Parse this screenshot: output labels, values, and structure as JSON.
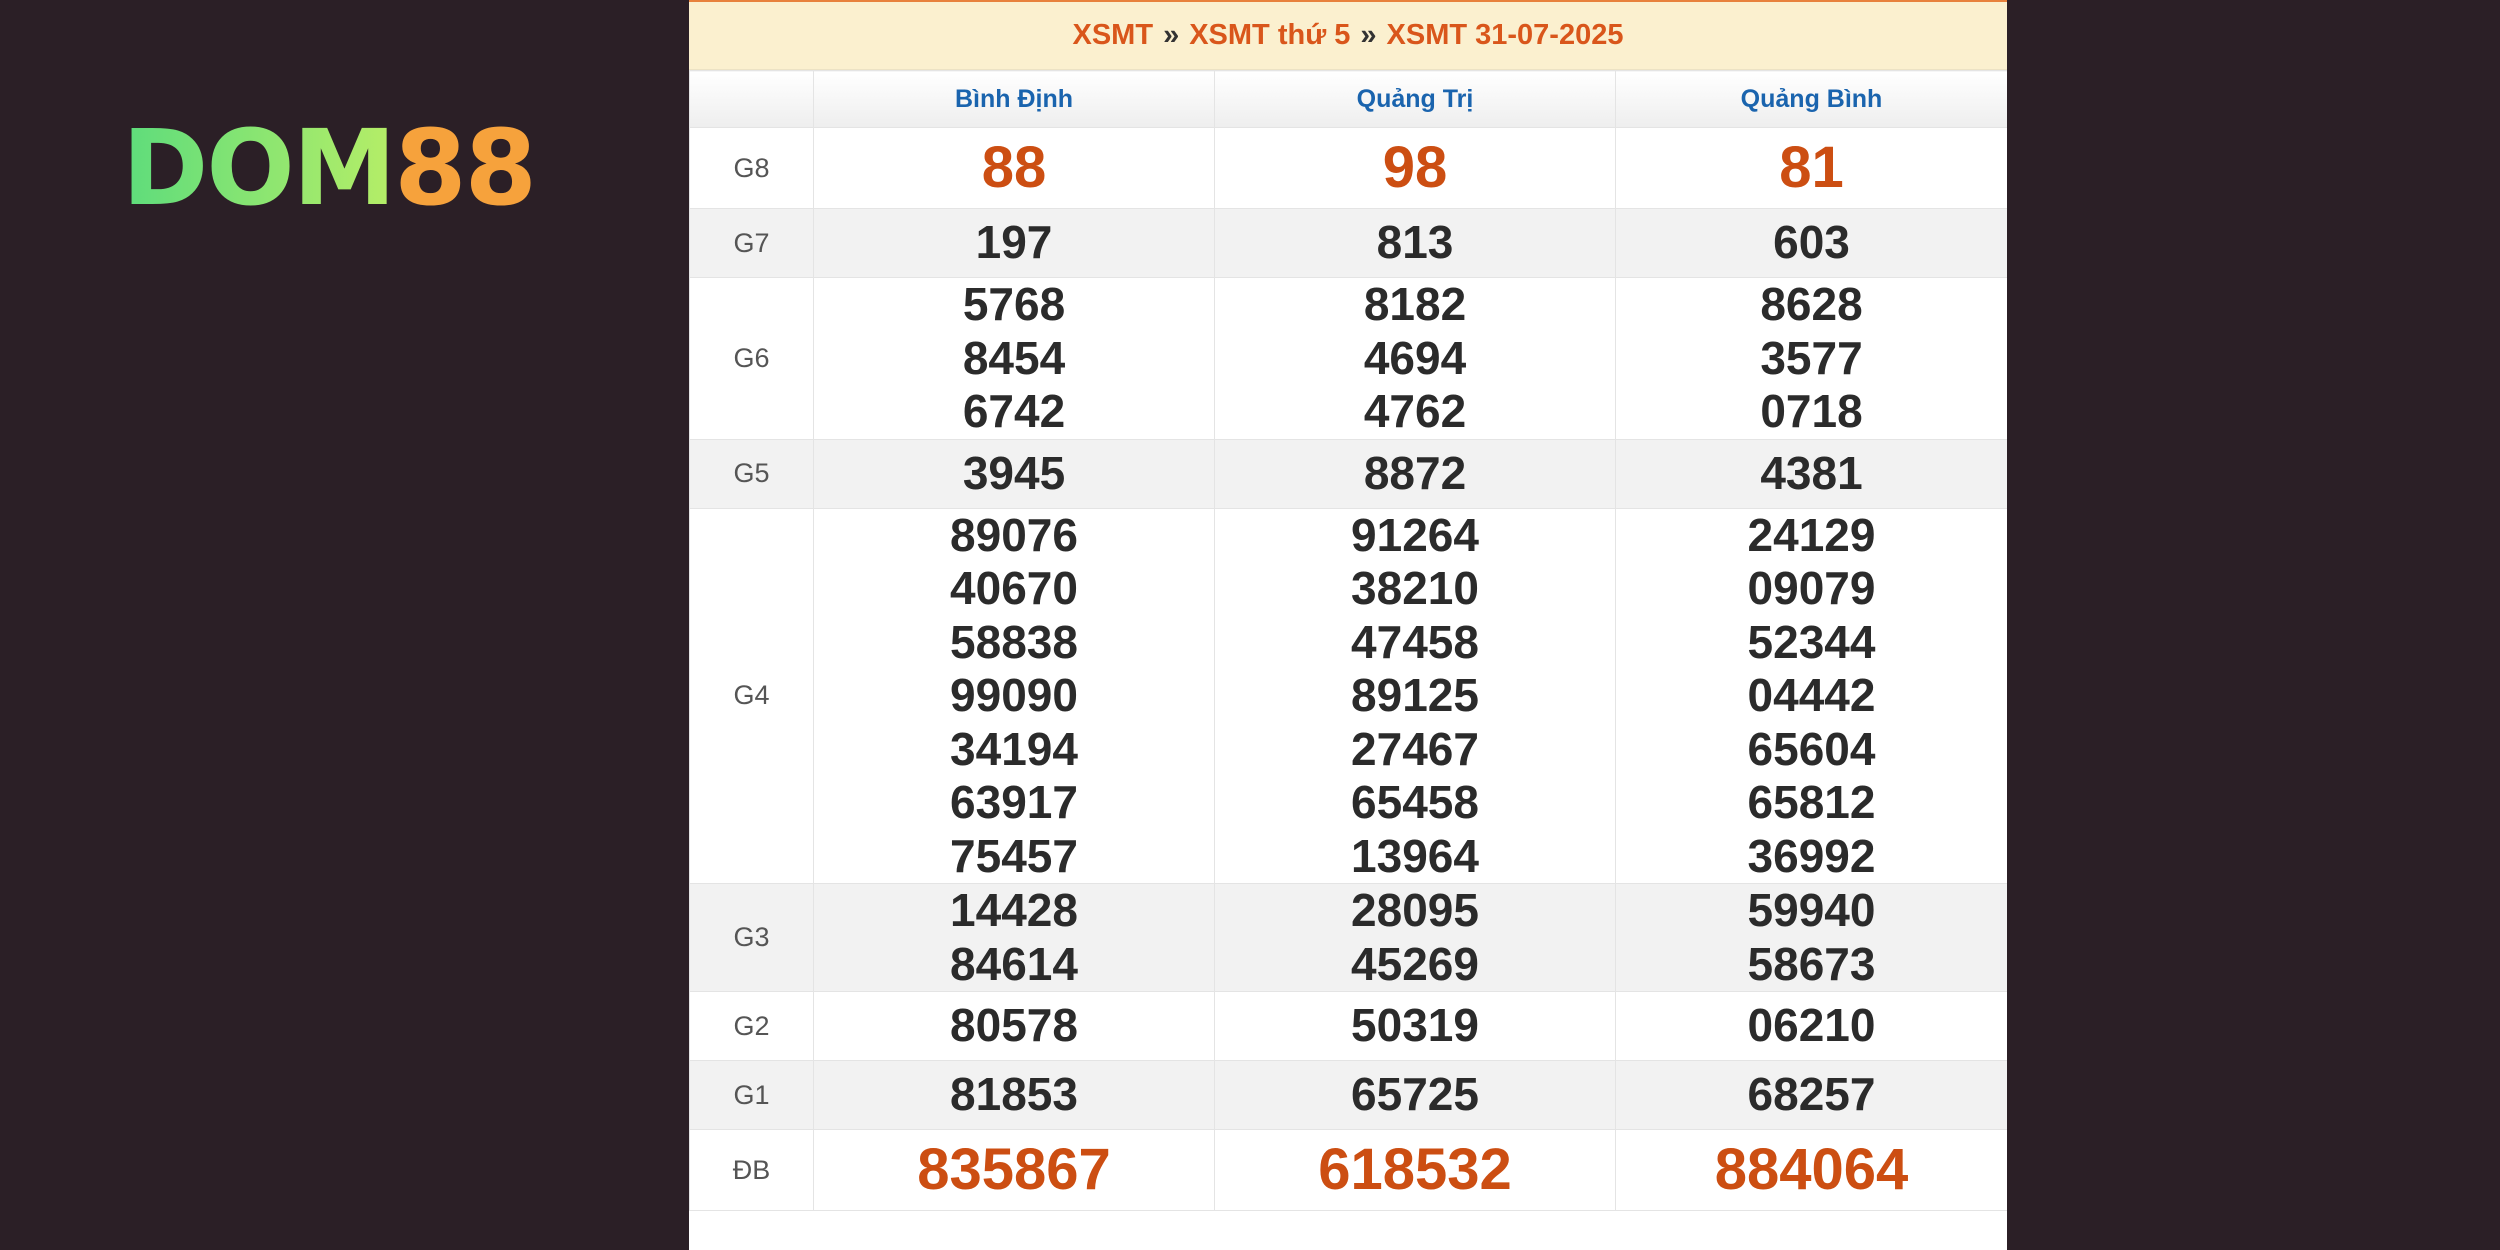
{
  "logo": {
    "text_dom": "DOM",
    "text_num": "88"
  },
  "header": {
    "crumb1": "XSMT",
    "sep1": "»",
    "crumb2": "XSMT thứ 5",
    "sep2": "»",
    "crumb3": "XSMT 31-07-2025"
  },
  "table": {
    "columns": [
      "Bình Định",
      "Quảng Trị",
      "Quảng Bình"
    ],
    "rows": [
      {
        "label": "G8",
        "values": [
          [
            "88"
          ],
          [
            "98"
          ],
          [
            "81"
          ]
        ]
      },
      {
        "label": "G7",
        "values": [
          [
            "197"
          ],
          [
            "813"
          ],
          [
            "603"
          ]
        ]
      },
      {
        "label": "G6",
        "values": [
          [
            "5768",
            "8454",
            "6742"
          ],
          [
            "8182",
            "4694",
            "4762"
          ],
          [
            "8628",
            "3577",
            "0718"
          ]
        ]
      },
      {
        "label": "G5",
        "values": [
          [
            "3945"
          ],
          [
            "8872"
          ],
          [
            "4381"
          ]
        ]
      },
      {
        "label": "G4",
        "values": [
          [
            "89076",
            "40670",
            "58838",
            "99090",
            "34194",
            "63917",
            "75457"
          ],
          [
            "91264",
            "38210",
            "47458",
            "89125",
            "27467",
            "65458",
            "13964"
          ],
          [
            "24129",
            "09079",
            "52344",
            "04442",
            "65604",
            "65812",
            "36992"
          ]
        ]
      },
      {
        "label": "G3",
        "values": [
          [
            "14428",
            "84614"
          ],
          [
            "28095",
            "45269"
          ],
          [
            "59940",
            "58673"
          ]
        ]
      },
      {
        "label": "G2",
        "values": [
          [
            "80578"
          ],
          [
            "50319"
          ],
          [
            "06210"
          ]
        ]
      },
      {
        "label": "G1",
        "values": [
          [
            "81853"
          ],
          [
            "65725"
          ],
          [
            "68257"
          ]
        ]
      },
      {
        "label": "ĐB",
        "values": [
          [
            "835867"
          ],
          [
            "618532"
          ],
          [
            "884064"
          ]
        ]
      }
    ]
  },
  "colors": {
    "background": "#2b1f26",
    "title_bar": "#fbf0cf",
    "title_text": "#d9561b",
    "province_header_text": "#1a64ae",
    "highlight_number": "#cc4e12",
    "number_text": "#2b2b2b",
    "alt_row": "#f2f2f2"
  }
}
